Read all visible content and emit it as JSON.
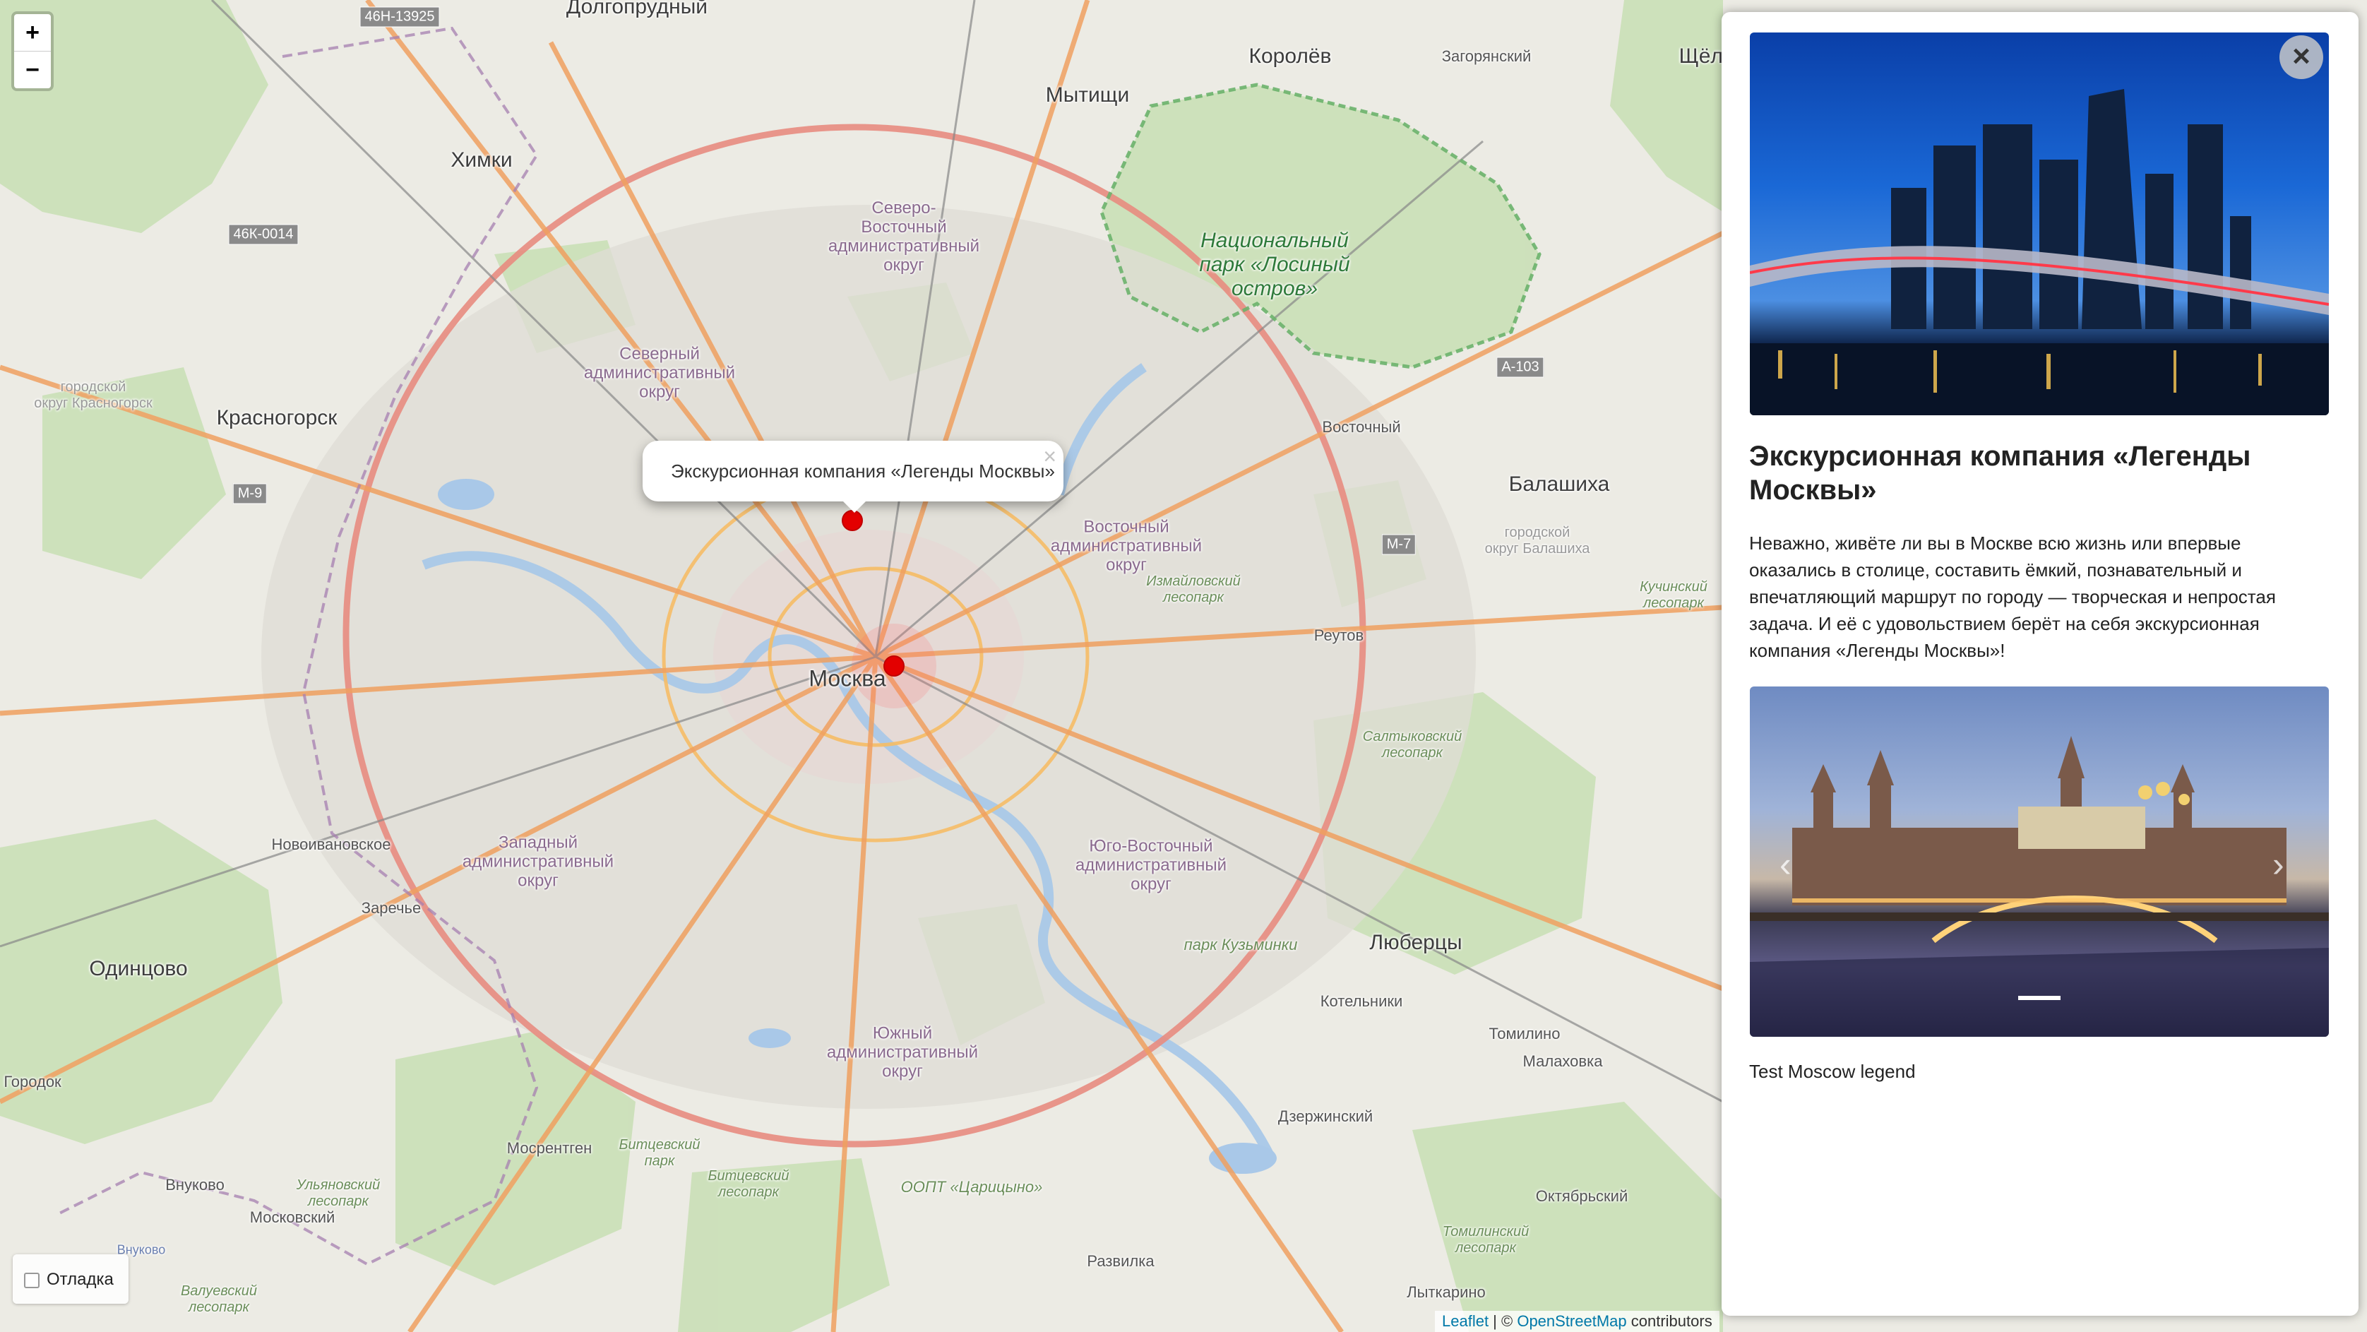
{
  "map": {
    "labels": {
      "dolgoprudny": "Долгопрудный",
      "korolev": "Королёв",
      "zagoryansky": "Загорянский",
      "shchelkovo": "Щёлково",
      "mytishchi": "Мытищи",
      "khimki": "Химки",
      "nat_park": "Национальный\nпарк «Лосиный\nостров»",
      "sev_vost": "Северо-\nВосточный\nадминистративный\nокруг",
      "severny": "Северный\nадминистративный\nокруг",
      "krasnogorsk": "Красногорск",
      "gorod_krasnogorsk": "городской\nокруг Красногорск",
      "vostochny": "Восточный",
      "balashikha": "Балашиха",
      "gorod_balashikha": "городской\nокруг Балашиха",
      "vost_adm": "Восточный\nадминистративный\nокруг",
      "izmailovsky": "Измайловский\nлесопарк",
      "kuchinsky": "Кучинский\nлесопарк",
      "reutov": "Реутов",
      "moskva": "Москва",
      "saltykovsky": "Салтыковский\nлесопарк",
      "novoivanovskoe": "Новоивановское",
      "zapadny": "Западный\nадминистративный\nокруг",
      "yugo_vost": "Юго-Восточный\nадминистративный\nокруг",
      "zarechye": "Заречье",
      "odintsovo": "Одинцово",
      "lyubertsy": "Люберцы",
      "park_kuzminki": "парк Кузьминки",
      "kotelniki": "Котельники",
      "yuzhny": "Южный\nадминистративный\nокруг",
      "tomilino": "Томилино",
      "gorodok": "Городок",
      "malakhovka": "Малаховка",
      "dzerzhinsky": "Дзержинский",
      "mosrentgen": "Мосрентген",
      "bitsevsky_park": "Битцевский\nпарк",
      "bitsevsky_les": "Битцевский\nлесопарк",
      "vnukovo": "Внуково",
      "moskovsky": "Московский",
      "ulyanovsky": "Ульяновский\nлесопарк",
      "oopt": "ООПТ «Царицыно»",
      "oktyabrsky": "Октябрьский",
      "tomilinsky": "Томилинский\nлесопарк",
      "razvilka": "Развилка",
      "lytkarino": "Лыткарино",
      "valuevsky": "Валуевский\nлесопарк",
      "vnukovo_air": "Внуково"
    },
    "roads": {
      "r1": "46Н-13925",
      "r2": "46К-0014",
      "r3": "А-103",
      "r4": "М-9",
      "r5": "М-7"
    }
  },
  "zoom": {
    "in": "+",
    "out": "−"
  },
  "popup": {
    "text": "Экскурсионная компания «Легенды Москвы»",
    "close": "×"
  },
  "debug": {
    "label": "Отладка"
  },
  "attribution": {
    "leaflet": "Leaflet",
    "sep": " | © ",
    "osm": "OpenStreetMap",
    "contributors": " contributors"
  },
  "panel": {
    "close": "×",
    "title": "Экскурсионная компания «Легенды Москвы»",
    "description": "Неважно, живёте ли вы в Москве всю жизнь или впервые оказались в столице, составить ёмкий, познавательный и впечатляющий маршрут по городу — творческая и непростая задача. И её с удовольствием берёт на себя экскурсионная компания «Легенды Москвы»!",
    "caption": "Test Moscow legend",
    "carousel_prev": "‹",
    "carousel_next": "›"
  }
}
